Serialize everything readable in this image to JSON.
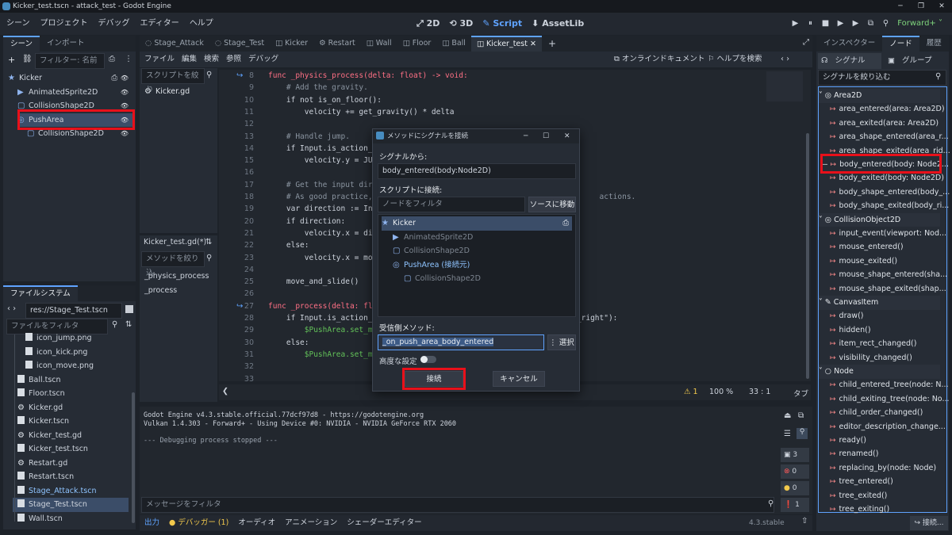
{
  "window": {
    "title": "Kicker_test.tscn - attack_test - Godot Engine",
    "buttons": [
      "─",
      "❐",
      "✕"
    ]
  },
  "menu": [
    "シーン",
    "プロジェクト",
    "デバッグ",
    "エディター",
    "ヘルプ"
  ],
  "modes": [
    {
      "icon": "⤢",
      "label": "2D"
    },
    {
      "icon": "⟲",
      "label": "3D"
    },
    {
      "icon": "✎",
      "label": "Script"
    },
    {
      "icon": "⬇",
      "label": "AssetLib"
    }
  ],
  "run_buttons": [
    "▶",
    "⏸",
    "■",
    "▶",
    "▶",
    "⧉",
    "⚲"
  ],
  "renderer": "Forward+ ˅",
  "scene_panel": {
    "tabs": [
      "シーン",
      "インポート"
    ],
    "filter_placeholder": "フィルター: 名前",
    "nodes": [
      {
        "name": "Kicker",
        "depth": 0
      },
      {
        "name": "AnimatedSprite2D",
        "depth": 1
      },
      {
        "name": "CollisionShape2D",
        "depth": 1
      },
      {
        "name": "PushArea",
        "depth": 1
      },
      {
        "name": "CollisionShape2D",
        "depth": 2
      }
    ]
  },
  "filesystem": {
    "tab": "ファイルシステム",
    "path": "res://Stage_Test.tscn",
    "filter_placeholder": "ファイルをフィルタ",
    "files": [
      "icon_jump.png",
      "icon_kick.png",
      "icon_move.png",
      "Ball.tscn",
      "Floor.tscn",
      "Kicker.gd",
      "Kicker.tscn",
      "Kicker_test.gd",
      "Kicker_test.tscn",
      "Restart.gd",
      "Restart.tscn",
      "Stage_Attack.tscn",
      "Stage_Test.tscn",
      "Wall.tscn"
    ]
  },
  "editor_tabs": [
    "Stage_Attack",
    "Stage_Test",
    "Kicker",
    "Restart",
    "Wall",
    "Floor",
    "Ball",
    "Kicker_test"
  ],
  "script_menu": [
    "ファイル",
    "編集",
    "検索",
    "参照",
    "デバッグ"
  ],
  "online_docs": "オンラインドキュメント",
  "help_search": "ヘルプを検索",
  "script_list": {
    "filter_placeholder": "スクリプトを絞り",
    "items": [
      "Kicker.gd"
    ]
  },
  "method_list": {
    "title": "Kicker_test.gd(*)",
    "filter_placeholder": "メソッドを絞り込",
    "items": [
      "_physics_process",
      "_process"
    ]
  },
  "code_lines": [
    {
      "n": "8",
      "t": "func _physics_process(delta: float) -> void:"
    },
    {
      "n": "9",
      "t": "    # Add the gravity."
    },
    {
      "n": "10",
      "t": "    if not is_on_floor():"
    },
    {
      "n": "11",
      "t": "        velocity += get_gravity() * delta"
    },
    {
      "n": "12",
      "t": ""
    },
    {
      "n": "13",
      "t": "    # Handle jump."
    },
    {
      "n": "14",
      "t": "    if Input.is_action_ju"
    },
    {
      "n": "15",
      "t": "        velocity.y = JUMP"
    },
    {
      "n": "16",
      "t": ""
    },
    {
      "n": "17",
      "t": "    # Get the input direc"
    },
    {
      "n": "18",
      "t": "    # As good practice, y                                                actions."
    },
    {
      "n": "19",
      "t": "    var direction := Inpu"
    },
    {
      "n": "20",
      "t": "    if direction:"
    },
    {
      "n": "21",
      "t": "        velocity.x = dire"
    },
    {
      "n": "22",
      "t": "    else:"
    },
    {
      "n": "23",
      "t": "        velocity.x = move"
    },
    {
      "n": "24",
      "t": ""
    },
    {
      "n": "25",
      "t": "    move_and_slide()"
    },
    {
      "n": "26",
      "t": ""
    },
    {
      "n": "27",
      "t": "func _process(delta: floa"
    },
    {
      "n": "28",
      "t": "    if Input.is_action_pr                                          e_right\"):"
    },
    {
      "n": "29",
      "t": "        $PushArea.set_mon"
    },
    {
      "n": "30",
      "t": "    else:"
    },
    {
      "n": "31",
      "t": "        $PushArea.set_mon"
    },
    {
      "n": "32",
      "t": ""
    },
    {
      "n": "33",
      "t": ""
    }
  ],
  "code_status": {
    "warnings": "⚠ 1",
    "zoom": "100 %",
    "pos": "33 :   1",
    "indent": "タブ"
  },
  "output": {
    "lines": [
      "Godot Engine v4.3.stable.official.77dcf97d8 - https://godotengine.org",
      "Vulkan 1.4.303 - Forward+ - Using Device #0: NVIDIA - NVIDIA GeForce RTX 2060",
      "",
      "--- Debugging process stopped ---"
    ],
    "filter_placeholder": "メッセージをフィルタ",
    "counts": [
      "3",
      "0",
      "0",
      "1"
    ]
  },
  "bottom_tabs": [
    "出力",
    "● デバッガー (1)",
    "オーディオ",
    "アニメーション",
    "シェーダーエディター"
  ],
  "version": "4.3.stable",
  "dialog": {
    "title": "メソッドにシグナルを接続",
    "from_label": "シグナルから:",
    "signal": "body_entered(body:Node2D)",
    "connect_label": "スクリプトに接続:",
    "node_filter": "ノードをフィルタ",
    "go_source": "ソースに移動",
    "tree": [
      {
        "name": "Kicker",
        "depth": 0
      },
      {
        "name": "AnimatedSprite2D",
        "depth": 1
      },
      {
        "name": "CollisionShape2D",
        "depth": 1
      },
      {
        "name": "PushArea (接続元)",
        "depth": 1
      },
      {
        "name": "CollisionShape2D",
        "depth": 2
      }
    ],
    "receiver_label": "受信側メソッド:",
    "receiver": "_on_push_area_body_entered",
    "pick": "選択",
    "advanced": "高度な設定",
    "connect": "接続",
    "cancel": "キャンセル"
  },
  "inspector": {
    "tabs": [
      "インスペクター",
      "ノード",
      "履歴"
    ],
    "subtabs": [
      "シグナル",
      "グループ"
    ],
    "filter_placeholder": "シグナルを絞り込む",
    "connect_button": "接続...",
    "rows": [
      {
        "cat": "Area2D"
      },
      {
        "sig": "area_entered(area: Area2D)"
      },
      {
        "sig": "area_exited(area: Area2D)"
      },
      {
        "sig": "area_shape_entered(area_r..."
      },
      {
        "sig": "area_shape_exited(area_rid..."
      },
      {
        "sig": "body_entered(body: Node2..."
      },
      {
        "sig": "body_exited(body: Node2D)"
      },
      {
        "sig": "body_shape_entered(body_..."
      },
      {
        "sig": "body_shape_exited(body_ri..."
      },
      {
        "cat": "CollisionObject2D"
      },
      {
        "sig": "input_event(viewport: Nod..."
      },
      {
        "sig": "mouse_entered()"
      },
      {
        "sig": "mouse_exited()"
      },
      {
        "sig": "mouse_shape_entered(sha..."
      },
      {
        "sig": "mouse_shape_exited(shap..."
      },
      {
        "cat": "CanvasItem"
      },
      {
        "sig": "draw()"
      },
      {
        "sig": "hidden()"
      },
      {
        "sig": "item_rect_changed()"
      },
      {
        "sig": "visibility_changed()"
      },
      {
        "cat": "Node"
      },
      {
        "sig": "child_entered_tree(node: N..."
      },
      {
        "sig": "child_exiting_tree(node: No..."
      },
      {
        "sig": "child_order_changed()"
      },
      {
        "sig": "editor_description_change..."
      },
      {
        "sig": "ready()"
      },
      {
        "sig": "renamed()"
      },
      {
        "sig": "replacing_by(node: Node)"
      },
      {
        "sig": "tree_entered()"
      },
      {
        "sig": "tree_exited()"
      },
      {
        "sig": "tree_exiting()"
      }
    ]
  }
}
